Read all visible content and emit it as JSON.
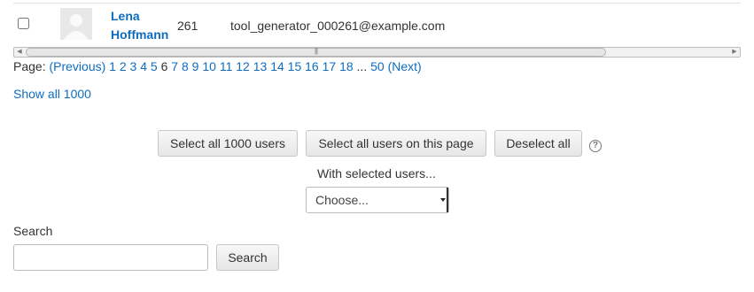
{
  "row": {
    "first_name": "Lena",
    "last_name": "Hoffmann",
    "id": "261",
    "email": "tool_generator_000261@example.com"
  },
  "paging": {
    "label": "Page:",
    "previous": "(Previous)",
    "pages": [
      "1",
      "2",
      "3",
      "4",
      "5",
      "6",
      "7",
      "8",
      "9",
      "10",
      "11",
      "12",
      "13",
      "14",
      "15",
      "16",
      "17",
      "18"
    ],
    "current": "6",
    "ellipsis": "...",
    "last": "50",
    "next": "(Next)"
  },
  "show_all": "Show all 1000",
  "buttons": {
    "select_all": "Select all 1000 users",
    "select_page": "Select all users on this page",
    "deselect": "Deselect all",
    "help": "?"
  },
  "with_selected": "With selected users...",
  "choose": "Choose...",
  "search": {
    "label": "Search",
    "button": "Search",
    "value": ""
  },
  "scrollbar": {
    "grip": "|||"
  }
}
